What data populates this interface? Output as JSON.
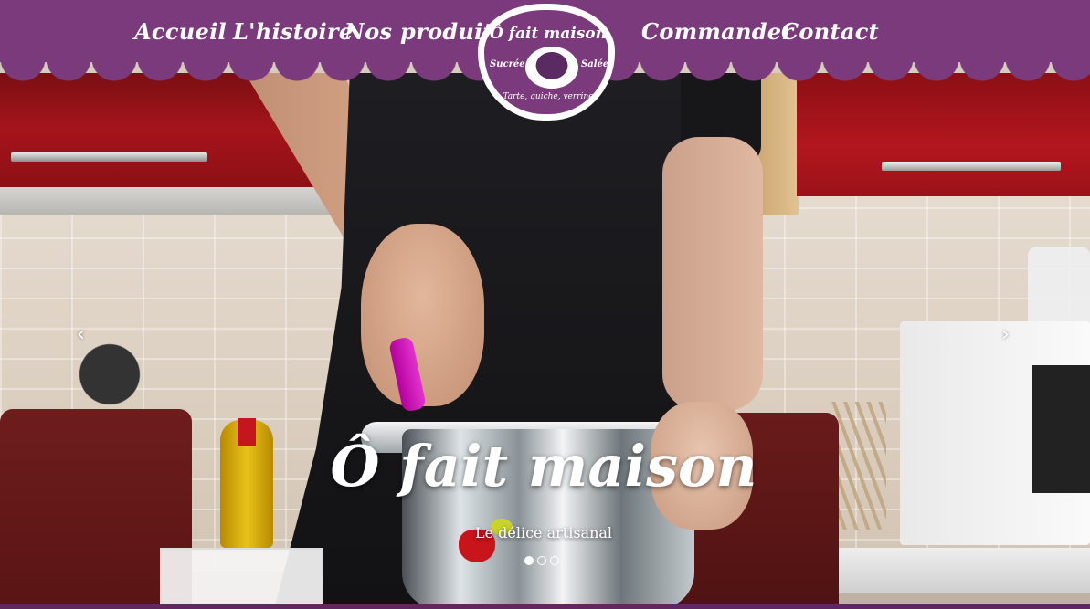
{
  "nav": {
    "items": [
      {
        "label": "Accueil"
      },
      {
        "label": "L'histoire"
      },
      {
        "label": "Nos produits"
      },
      {
        "label": "Commander"
      },
      {
        "label": "Contact"
      }
    ]
  },
  "logo": {
    "title": "Ô fait maison",
    "left_label": "Sucrée",
    "right_label": "Salée",
    "tagline": "Tarte, quiche, verrine"
  },
  "slider": {
    "prev_icon": "chevron-left-icon",
    "next_icon": "chevron-right-icon",
    "prev_glyph": "‹",
    "next_glyph": "›",
    "caption_title": "Ô fait maison",
    "caption_subtitle": "Le délice artisanal",
    "active_slide": 1,
    "slide_count": 3
  },
  "colors": {
    "brand_purple": "#7a3a7b",
    "text_white": "#ffffff"
  }
}
